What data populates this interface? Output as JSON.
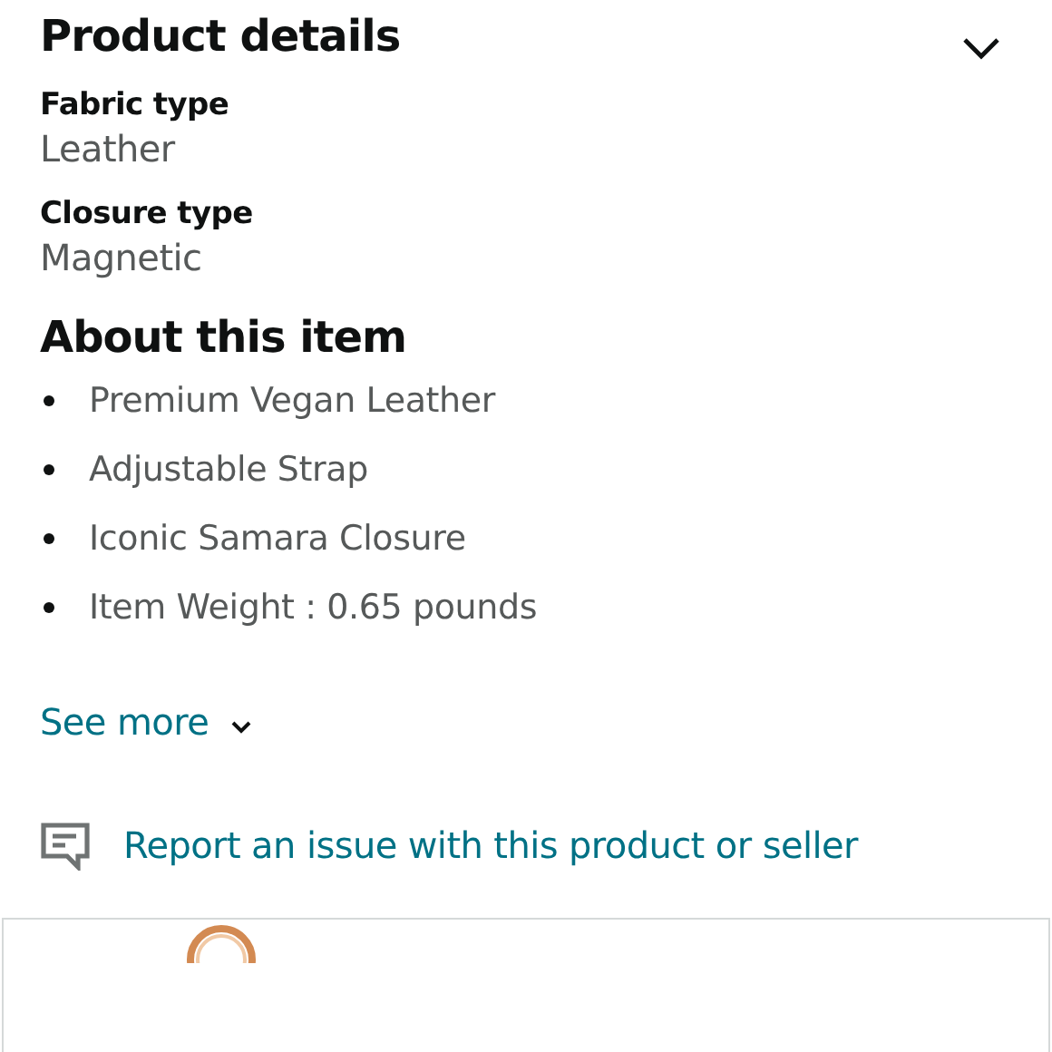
{
  "product_details": {
    "title": "Product details",
    "expanded": false,
    "attributes": [
      {
        "label": "Fabric type",
        "value": "Leather"
      },
      {
        "label": "Closure type",
        "value": "Magnetic"
      }
    ]
  },
  "about": {
    "title": "About this item",
    "bullets": [
      "Premium Vegan Leather",
      "Adjustable Strap",
      "Iconic Samara Closure",
      "Item Weight : 0.65 pounds"
    ],
    "see_more": "See more"
  },
  "report_link": "Report an issue with this product or seller"
}
